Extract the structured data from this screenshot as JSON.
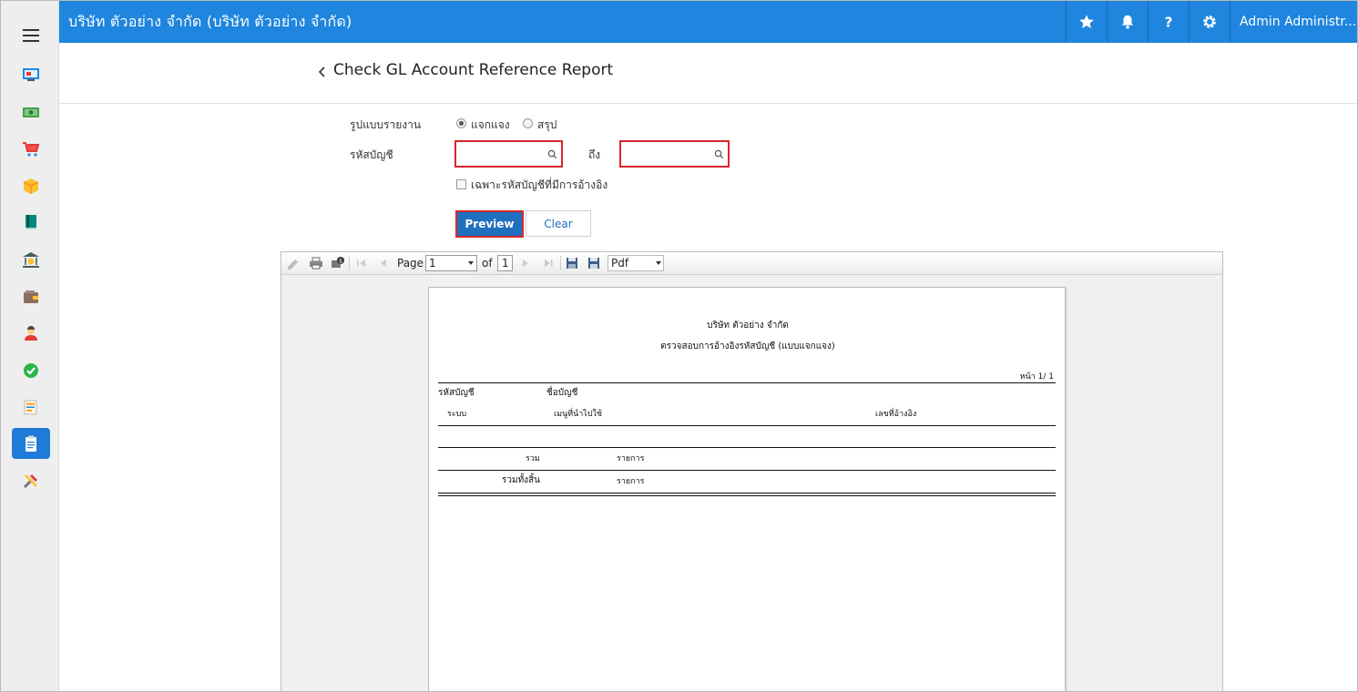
{
  "topbar": {
    "company": "บริษัท ตัวอย่าง จำกัด (บริษัท ตัวอย่าง จำกัด)",
    "user": "Admin Administr..."
  },
  "sidebar": {
    "items": [
      "display-icon",
      "money-icon",
      "cart-icon",
      "box-icon",
      "book-icon",
      "bank-icon",
      "wallet-icon",
      "person-icon",
      "check-circle-icon",
      "list-icon",
      "clipboard-icon",
      "tools-icon"
    ],
    "active_index": 10
  },
  "page": {
    "title": "Check GL Account Reference Report"
  },
  "form": {
    "report_type_label": "รูปแบบรายงาน",
    "radio_detail": "แจกแจง",
    "radio_summary": "สรุป",
    "account_label": "รหัสบัญชี",
    "to_label": "ถึง",
    "account_from_value": "",
    "account_to_value": "",
    "only_ref_label": "เฉพาะรหัสบัญชีที่มีการอ้างอิง",
    "preview_button": "Preview",
    "clear_button": "Clear"
  },
  "viewer": {
    "page_label": "Page",
    "page_value": "1",
    "of_label": "of",
    "total_pages": "1",
    "format_value": "Pdf"
  },
  "report": {
    "company": "บริษัท ตัวอย่าง จำกัด",
    "title": "ตรวจสอบการอ้างอิงรหัสบัญชี (แบบแจกแจง)",
    "page_info": "หน้า 1/ 1",
    "col_account_code": "รหัสบัญชี",
    "col_account_name": "ชื่อบัญชี",
    "col_system": "ระบบ",
    "col_menu": "เมนูที่นำไปใช้",
    "col_ref_doc": "เลขที่อ้างอิง",
    "total_label": "รวม",
    "total_items": "รายการ",
    "grand_total_label": "รวมทั้งสิ้น",
    "grand_total_items": "รายการ"
  }
}
